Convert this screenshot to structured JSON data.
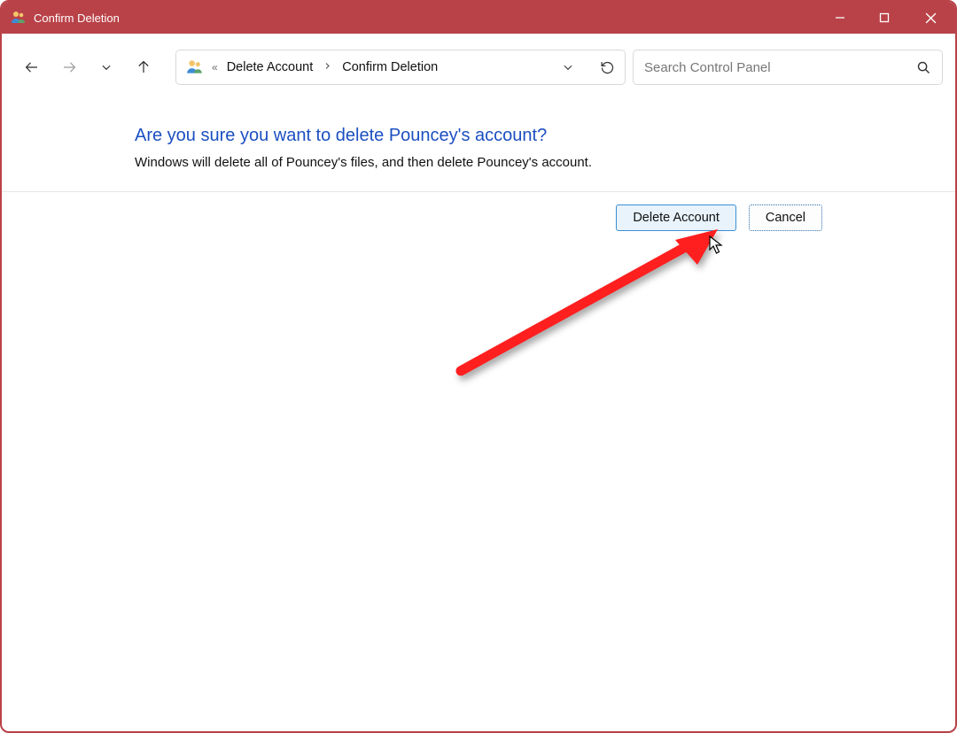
{
  "titlebar": {
    "title": "Confirm Deletion"
  },
  "breadcrumb": {
    "item1": "Delete Account",
    "item2": "Confirm Deletion"
  },
  "search": {
    "placeholder": "Search Control Panel"
  },
  "main": {
    "heading": "Are you sure you want to delete Pouncey's account?",
    "subtext": "Windows will delete all of Pouncey's files, and then delete Pouncey's account."
  },
  "buttons": {
    "delete": "Delete Account",
    "cancel": "Cancel"
  }
}
